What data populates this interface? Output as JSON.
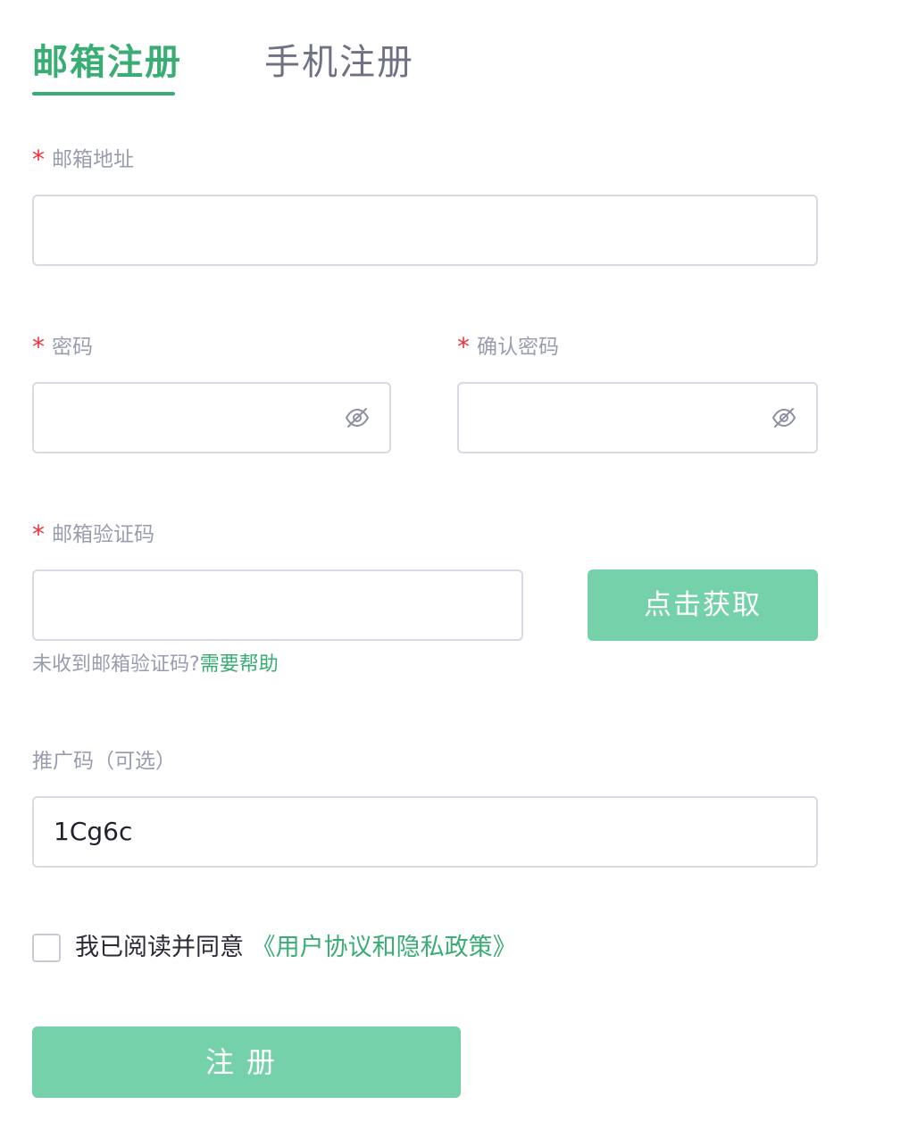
{
  "tabs": {
    "email": "邮箱注册",
    "phone": "手机注册"
  },
  "email_field": {
    "required_mark": "*",
    "label": "邮箱地址",
    "value": ""
  },
  "password_field": {
    "required_mark": "*",
    "label": "密码",
    "value": "",
    "toggle_icon": "eye-off-icon"
  },
  "confirm_password_field": {
    "required_mark": "*",
    "label": "确认密码",
    "value": "",
    "toggle_icon": "eye-off-icon"
  },
  "code_field": {
    "required_mark": "*",
    "label": "邮箱验证码",
    "value": "",
    "button_label": "点击获取",
    "help_text": "未收到邮箱验证码?",
    "help_link": "需要帮助"
  },
  "referral_field": {
    "label": "推广码（可选）",
    "value": "1Cg6c"
  },
  "agreement": {
    "text": "我已阅读并同意",
    "link": "《用户协议和隐私政策》",
    "checked": false
  },
  "submit": {
    "label": "注册"
  },
  "colors": {
    "accent": "#3aad74",
    "button_bg": "#75d1aa",
    "required": "#f0303a",
    "label": "#9a9cb0",
    "border": "#d8d9e3"
  }
}
